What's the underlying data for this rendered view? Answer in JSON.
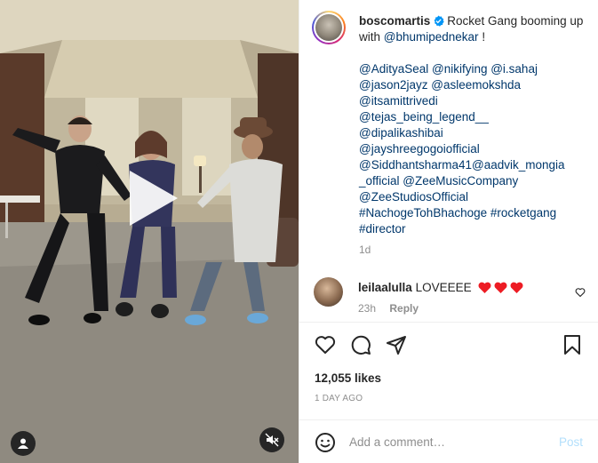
{
  "post": {
    "username": "boscomartis",
    "caption_first": "Rocket Gang booming up with",
    "caption_mention": "@bhumipednekar",
    "caption_bang": "!",
    "tag_lines": [
      "@AdityaSeal @nikifying @i.sahaj",
      "@jason2jayz @asleemokshda",
      "@itsamittrivedi",
      "@tejas_being_legend__",
      "@dipalikashibai",
      "@jayshreegogoiofficial",
      "@Siddhantsharma41@aadvik_mongia",
      "_official @ZeeMusicCompany",
      "@ZeeStudiosOfficial",
      "#NachogeTohBhachoge #rocketgang",
      "#director"
    ],
    "caption_time": "1d",
    "comment": {
      "username": "leilaalulla",
      "text": "LOVEEEE",
      "time": "23h",
      "reply_label": "Reply"
    },
    "likes": "12,055 likes",
    "date": "1 DAY AGO",
    "add_comment": {
      "placeholder": "Add a comment…",
      "post_label": "Post"
    }
  },
  "icons": {
    "verified": "verified-badge-icon",
    "heart": "heart-icon",
    "comment": "comment-icon",
    "share": "share-icon",
    "save": "bookmark-icon",
    "emoji": "emoji-icon",
    "play": "play-icon",
    "mute": "mute-icon",
    "user_tags": "user-tag-icon"
  },
  "colors": {
    "verified": "#0095f6",
    "link": "#00376b",
    "heart_red": "#ed4956",
    "muted": "#8e8e8e",
    "post_disabled": "#b2dffc"
  }
}
